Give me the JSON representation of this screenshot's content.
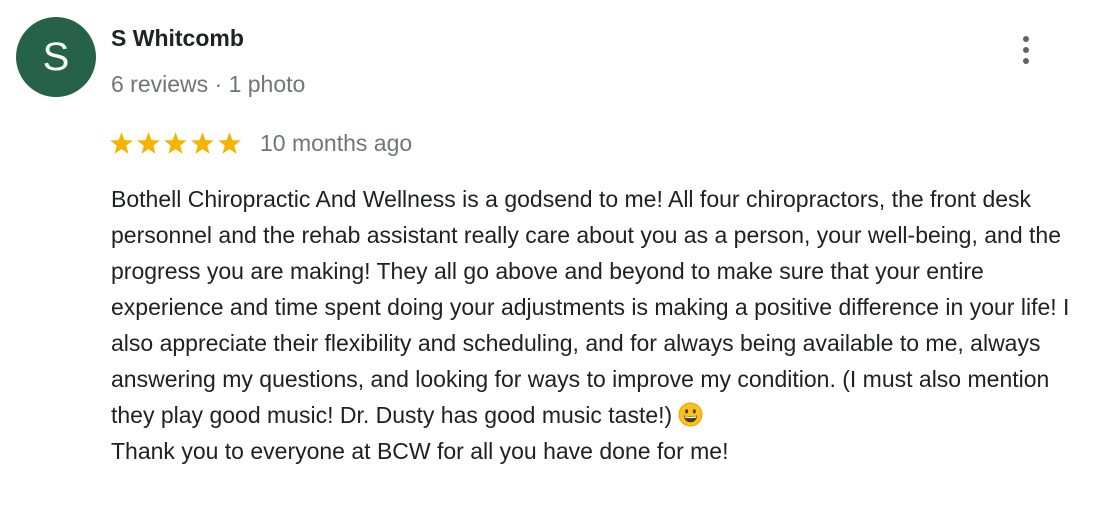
{
  "author": {
    "initial": "S",
    "name": "S Whitcomb",
    "meta": "6 reviews · 1 photo",
    "avatar_color": "#256247"
  },
  "rating": {
    "stars": 5,
    "max": 5,
    "star_color": "#f4b400"
  },
  "review": {
    "date": "10 months ago",
    "paragraph_1": "Bothell Chiropractic And Wellness is a godsend to me! All four chiropractors, the front desk personnel and the rehab assistant really care about you as a person, your well-being, and the progress you are making! They all go above and beyond to make sure that your entire experience and time spent doing your adjustments is making a positive difference in your life! I also appreciate their flexibility and scheduling, and for always being available to me, always answering my questions, and looking for ways to improve my condition. (I must also mention they play good music! Dr. Dusty has good music taste!)",
    "emoji": "grinning-face-emoji",
    "paragraph_2": "Thank you to everyone at BCW for all you have done for me!"
  },
  "menu": {
    "icon": "more-vert-icon"
  }
}
